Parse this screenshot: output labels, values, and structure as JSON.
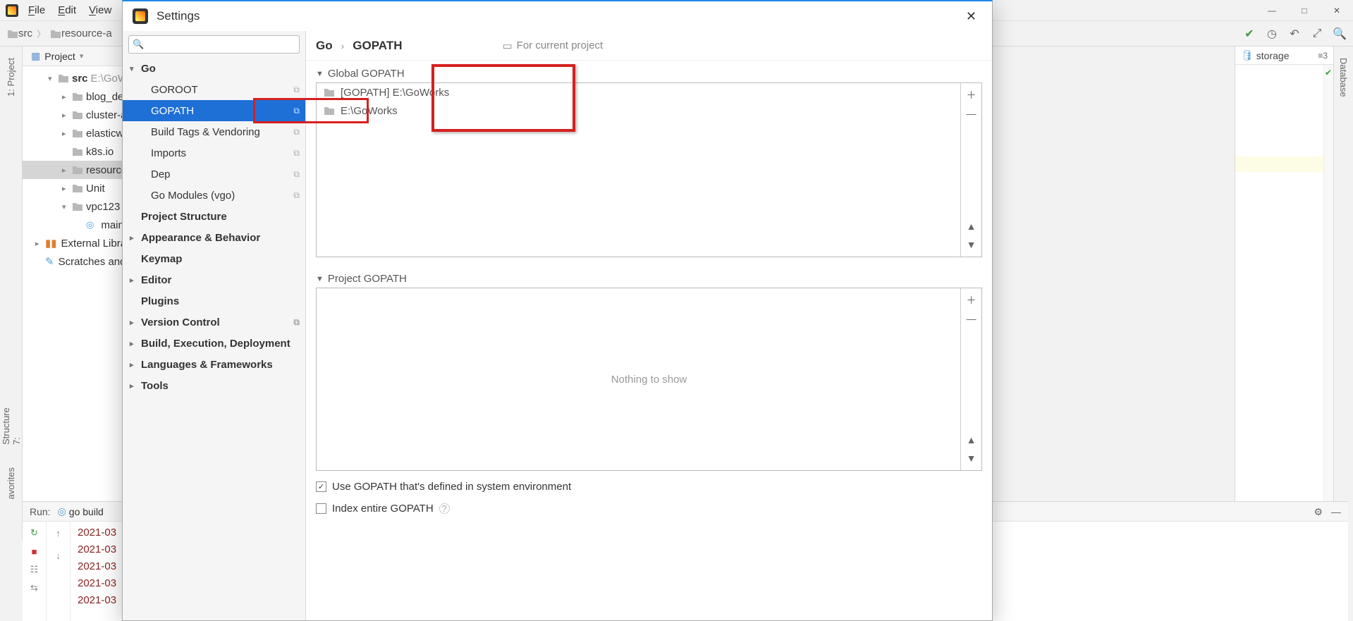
{
  "menubar": [
    "File",
    "Edit",
    "View"
  ],
  "win": {
    "min": "—",
    "max": "□",
    "close": "✕"
  },
  "nav": {
    "crumbs": [
      "src",
      "resource-a"
    ],
    "storage_tab": "storage",
    "eq_badge": "≡3"
  },
  "left_stripe": {
    "project": "1: Project",
    "structure": "7: Structure",
    "fav": "avorites"
  },
  "right_stripe": {
    "database": "Database"
  },
  "project": {
    "header": "Project",
    "root": "src",
    "root_path": "E:\\GoWor",
    "items": [
      {
        "lvl": 2,
        "arw": ">",
        "icon": "folder",
        "label": "blog_dem"
      },
      {
        "lvl": 2,
        "arw": ">",
        "icon": "folder",
        "label": "cluster-ag"
      },
      {
        "lvl": 2,
        "arw": ">",
        "icon": "folder",
        "label": "elasticweb"
      },
      {
        "lvl": 2,
        "arw": "",
        "icon": "folder",
        "label": "k8s.io"
      },
      {
        "lvl": 2,
        "arw": ">",
        "icon": "folder",
        "label": "resource-a",
        "sel": true
      },
      {
        "lvl": 2,
        "arw": ">",
        "icon": "folder",
        "label": "Unit"
      },
      {
        "lvl": 2,
        "arw": "v",
        "icon": "folder",
        "label": "vpc123"
      },
      {
        "lvl": 3,
        "arw": "",
        "icon": "go",
        "label": "main.g"
      }
    ],
    "extra": [
      {
        "lvl": 1,
        "arw": ">",
        "icon": "lib",
        "label": "External Libra"
      },
      {
        "lvl": 1,
        "arw": "",
        "icon": "scratch",
        "label": "Scratches and"
      }
    ]
  },
  "run": {
    "title": "Run:",
    "config": "go build",
    "lines": [
      "2021-03",
      "2021-03",
      "2021-03",
      "2021-03",
      "2021-03"
    ]
  },
  "editor": {
    "tab": "storage"
  },
  "settings": {
    "title": "Settings",
    "search_ph": "",
    "categories": [
      {
        "type": "parent",
        "label": "Go",
        "arw": "v"
      },
      {
        "type": "child",
        "label": "GOROOT"
      },
      {
        "type": "child",
        "label": "GOPATH",
        "sel": true
      },
      {
        "type": "child",
        "label": "Build Tags & Vendoring"
      },
      {
        "type": "child",
        "label": "Imports"
      },
      {
        "type": "child",
        "label": "Dep"
      },
      {
        "type": "child",
        "label": "Go Modules (vgo)"
      },
      {
        "type": "parent",
        "label": "Project Structure",
        "arw": ""
      },
      {
        "type": "parent",
        "label": "Appearance & Behavior",
        "arw": ">"
      },
      {
        "type": "parent",
        "label": "Keymap",
        "arw": ""
      },
      {
        "type": "parent",
        "label": "Editor",
        "arw": ">"
      },
      {
        "type": "parent",
        "label": "Plugins",
        "arw": ""
      },
      {
        "type": "parent",
        "label": "Version Control",
        "arw": ">",
        "copy": true
      },
      {
        "type": "parent",
        "label": "Build, Execution, Deployment",
        "arw": ">"
      },
      {
        "type": "parent",
        "label": "Languages & Frameworks",
        "arw": ">"
      },
      {
        "type": "parent",
        "label": "Tools",
        "arw": ">"
      }
    ],
    "breadcrumb": [
      "Go",
      "GOPATH"
    ],
    "scope_label": "For current project",
    "global": {
      "title": "Global GOPATH",
      "rows": [
        "[GOPATH] E:\\GoWorks",
        "E:\\GoWorks"
      ]
    },
    "project_section": {
      "title": "Project GOPATH",
      "empty": "Nothing to show"
    },
    "chk1": "Use GOPATH that's defined in system environment",
    "chk2": "Index entire GOPATH"
  }
}
